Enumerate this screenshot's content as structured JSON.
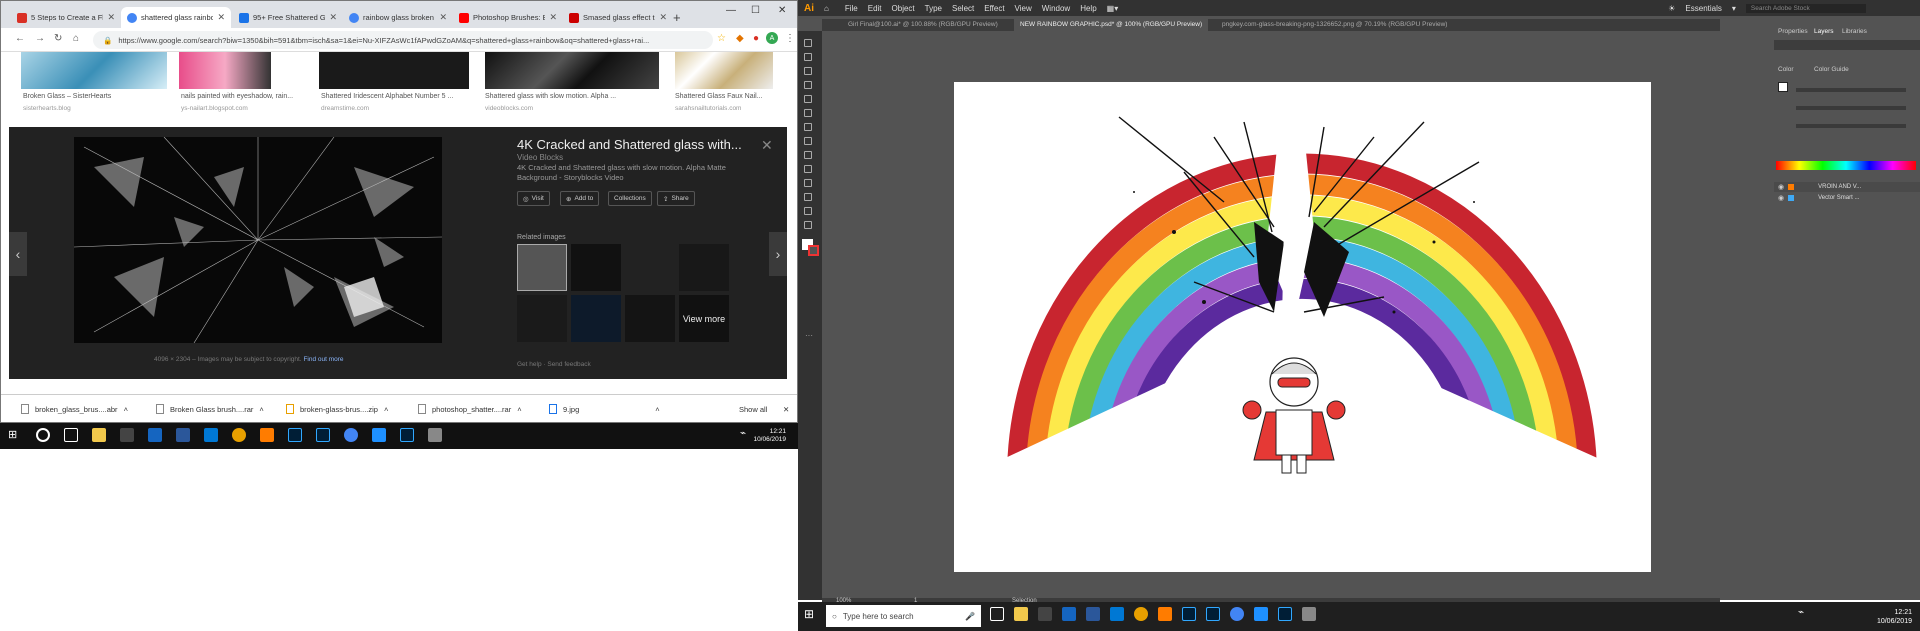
{
  "chrome": {
    "tabs": [
      {
        "label": "5 Steps to Create a Flat",
        "color": "#d93025"
      },
      {
        "label": "shattered glass rainbow",
        "color": "#4285f4"
      },
      {
        "label": "95+ Free Shattered Gla",
        "color": "#1a73e8"
      },
      {
        "label": "rainbow glass broken",
        "color": "#4285f4"
      },
      {
        "label": "Photoshop Brushes: Br",
        "color": "#ff0000"
      },
      {
        "label": "Smased glass effect tu",
        "color": "#c00"
      }
    ],
    "new_tab": "+",
    "url": "https://www.google.com/search?biw=1350&bih=591&tbm=isch&sa=1&ei=Nu-XIFZAsWc1fAPwdGZoAM&q=shattered+glass+rainbow&oq=shattered+glass+rai...",
    "results": [
      {
        "caption": "Broken Glass – SisterHearts",
        "source": "sisterhearts.blog"
      },
      {
        "caption": "nails painted with eyeshadow, rain...",
        "source": "ys-nailart.blogspot.com"
      },
      {
        "caption": "Shattered Iridescent Alphabet Number 5 ...",
        "source": "dreamstime.com"
      },
      {
        "caption": "Shattered glass with slow motion. Alpha ...",
        "source": "videoblocks.com"
      },
      {
        "caption": "Shattered Glass Faux Nail...",
        "source": "sarahsnailtutorials.com"
      }
    ],
    "preview": {
      "title": "4K Cracked and Shattered glass with...",
      "source": "Video Blocks",
      "description": "4K Cracked and Shattered glass with slow motion. Alpha Matte Background - Storyblocks Video",
      "buttons": [
        "Visit",
        "Add to",
        "Collections",
        "Share"
      ],
      "related_label": "Related images",
      "view_more": "View more",
      "dims": "4096 × 2304",
      "copyright": "Images may be subject to copyright.",
      "find_out": "Find out more",
      "get_help": "Get help",
      "feedback": "Send feedback"
    },
    "downloads": [
      "broken_glass_brus....abr",
      "Broken Glass brush....rar",
      "broken-glass-brus....zip",
      "photoshop_shatter....rar",
      "9.jpg"
    ],
    "show_all": "Show all",
    "clock_time": "12:21",
    "clock_date": "10/06/2019"
  },
  "illustrator": {
    "logo": "Ai",
    "menu": [
      "File",
      "Edit",
      "Object",
      "Type",
      "Select",
      "Effect",
      "View",
      "Window",
      "Help"
    ],
    "workspace": "Essentials",
    "search_placeholder": "Search Adobe Stock",
    "doc_tabs": [
      "Girl Final@100.ai* @ 100.88% (RGB/GPU Preview)",
      "NEW RAINBOW GRAPHIC.psd* @ 100% (RGB/GPU Preview)",
      "pngkey.com-glass-breaking-png-1326652.png @ 70.19% (RGB/GPU Preview)"
    ],
    "panel_tabs": [
      "Properties",
      "Layers",
      "Libraries"
    ],
    "color_tab": "Color",
    "color_guide_tab": "Color Guide",
    "layers": [
      "Vector Smart ...",
      "VROIN AND V..."
    ],
    "zoom": "100%",
    "page": "1",
    "tool_status": "Selection",
    "rainbow_colors": [
      "#c8252f",
      "#f5821f",
      "#fde94b",
      "#6cc04a",
      "#3fb5e0",
      "#9957c6",
      "#5b2a9e"
    ],
    "search_box": "Type here to search",
    "clock_time": "12:21",
    "clock_date": "10/06/2019"
  }
}
